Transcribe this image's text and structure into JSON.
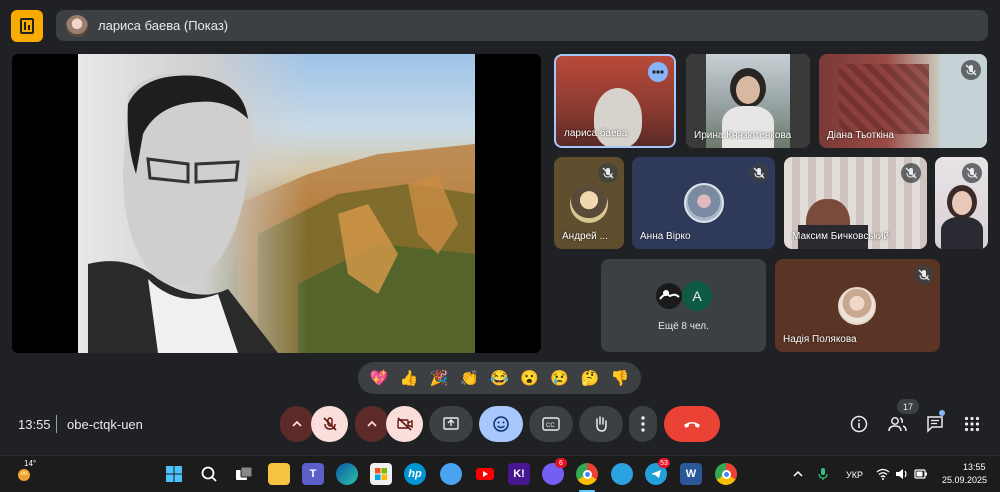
{
  "header": {
    "presenter_label": "лариса баева (Показ)"
  },
  "participants": {
    "tile1": {
      "name": "лариса баева",
      "status": "speaking"
    },
    "tile2": {
      "name": "Ирина Князютенкова"
    },
    "tile3": {
      "name": "Діана Тьоткіна",
      "status": "muted"
    },
    "tile4": {
      "name": "Андрей ...",
      "status": "muted"
    },
    "tile5": {
      "name": "Анна Вірко",
      "status": "muted"
    },
    "tile6": {
      "name": "Максим Бичковський",
      "status": "muted"
    },
    "tile7": {
      "status": "muted"
    },
    "more": {
      "label": "Ещё 8 чел.",
      "avatar_letter": "A"
    },
    "tile8": {
      "name": "Надія Полякова",
      "status": "muted"
    }
  },
  "reactions": [
    "💖",
    "👍",
    "🎉",
    "👏",
    "😂",
    "😮",
    "😢",
    "🤔",
    "👎"
  ],
  "bottom_bar": {
    "time": "13:55",
    "meeting_code": "obe-ctqk-uen",
    "participants_count": "17"
  },
  "taskbar": {
    "temperature": "14°",
    "language": "УКР",
    "time": "13:55",
    "date": "25.09.2025",
    "viber_badge": "6",
    "telegram_badge": "53",
    "apps": [
      "start",
      "search",
      "task-view",
      "file-explorer",
      "teams",
      "edge",
      "store",
      "hp",
      "app-yellow",
      "youtube",
      "kahoot",
      "viber",
      "chrome",
      "telegram",
      "word",
      "chrome-profile"
    ]
  },
  "colors": {
    "background": "#202124",
    "surface": "#3c4043",
    "accent": "#8ab4f8",
    "danger": "#ea4335",
    "logo": "#f9ab00"
  }
}
